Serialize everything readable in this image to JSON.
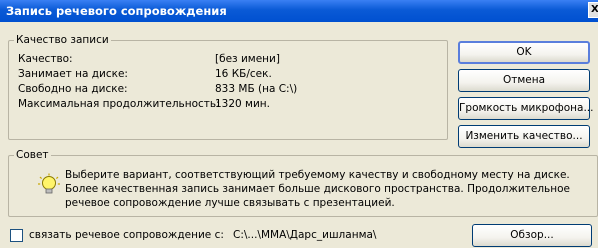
{
  "window": {
    "title": "Запись речевого сопровождения",
    "close_glyph": "X"
  },
  "quality_group": {
    "legend": "Качество записи",
    "rows": [
      {
        "label": "Качество:",
        "value": "[без имени]"
      },
      {
        "label": "Занимает на диске:",
        "value": "16 КБ/сек."
      },
      {
        "label": "Свободно на диске:",
        "value": "833 МБ (на C:\\)"
      },
      {
        "label": "Максимальная продолжительность:",
        "value": "1320 мин."
      }
    ]
  },
  "buttons": {
    "ok": "OK",
    "cancel": "Отмена",
    "mic_volume": "Громкость микрофона...",
    "change_quality": "Изменить качество...",
    "browse": "Обзор..."
  },
  "tip": {
    "legend": "Совет",
    "text": "Выберите вариант, соответствующий требуемому качеству и свободному месту на диске. Более качественная запись занимает больше дискового пространства. Продолжительное речевое сопровождение лучше связывать с презентацией.",
    "icon": "lightbulb-icon"
  },
  "link_option": {
    "label": "связать речевое сопровождение с:",
    "checked": false,
    "path": "C:\\...\\MMA\\Дарс_ишланма\\"
  },
  "colors": {
    "title_bar": "#0a5ad6",
    "dialog_bg": "#ece9d8",
    "button_border": "#003c74"
  }
}
